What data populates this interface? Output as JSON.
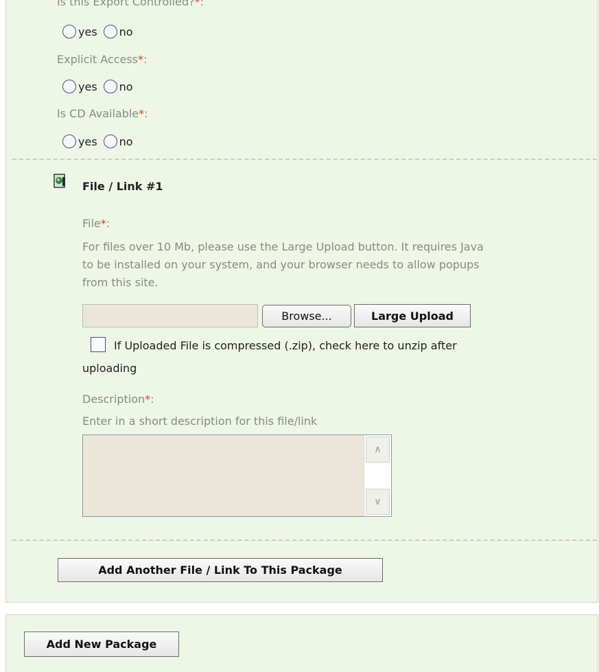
{
  "form": {
    "export_controlled_label": "Is this Export Controlled?",
    "export_controlled_suffix": ":",
    "explicit_access_label": "Explicit Access",
    "cd_available_label": "Is CD Available",
    "required_mark": "*",
    "colon": ":",
    "yes": "yes",
    "no": "no"
  },
  "file_section": {
    "title": "File / Link #1",
    "file_label": "File",
    "file_help_line1": "For files over 10 Mb, please use the Large Upload button. It requires Java",
    "file_help_line2": "to be installed on your system, and your browser needs to allow popups",
    "file_help_line3": "from this site.",
    "browse_label": "Browse...",
    "large_upload_label": "Large Upload",
    "unzip_line1": "If Uploaded File is compressed (.zip), check here to unzip after",
    "unzip_line2": "uploading",
    "description_label": "Description",
    "description_help": "Enter in a short description for this file/link",
    "description_value": ""
  },
  "actions": {
    "add_file_label": "Add Another File / Link To This Package",
    "add_package_label": "Add New Package"
  },
  "icons": {
    "file": "file-link-icon",
    "scroll_up": "chevron-up-icon",
    "scroll_down": "chevron-down-icon"
  },
  "colors": {
    "panel_bg": "#eef6e6",
    "required": "#e03a2a",
    "muted_text": "#8a8a80"
  }
}
